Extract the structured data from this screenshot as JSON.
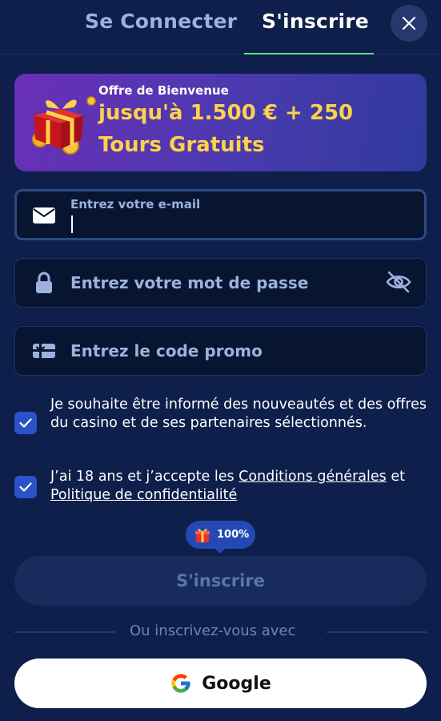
{
  "tabs": {
    "login": "Se Connecter",
    "signup": "S'inscrire",
    "active": "signup"
  },
  "banner": {
    "subtitle": "Offre de Bienvenue",
    "line1": "jusqu'à 1.500 € + 250",
    "line2": "Tours Gratuits"
  },
  "form": {
    "email": {
      "label": "Entrez votre e-mail",
      "value": ""
    },
    "password": {
      "placeholder": "Entrez votre mot de passe"
    },
    "promo": {
      "placeholder": "Entrez le code promo"
    }
  },
  "consents": {
    "newsletter": {
      "checked": true,
      "text": "Je souhaite être informé des nouveautés et des offres du casino et de ses partenaires sélectionnés."
    },
    "terms": {
      "checked": true,
      "prefix": "J’ai 18 ans et j’accepte les ",
      "terms_link": "Conditions générales",
      "middle": " et ",
      "privacy_link": "Politique de confidentialité"
    }
  },
  "progress_badge": {
    "text": "100%",
    "value_percent": 100
  },
  "submit_label": "S'inscrire",
  "divider_text": "Ou inscrivez-vous avec",
  "google_label": "Google",
  "colors": {
    "background": "#0d1f4a",
    "accent_underline": "#5ee08c",
    "banner_text": "#ffd24a",
    "checkbox": "#2a52c9"
  }
}
